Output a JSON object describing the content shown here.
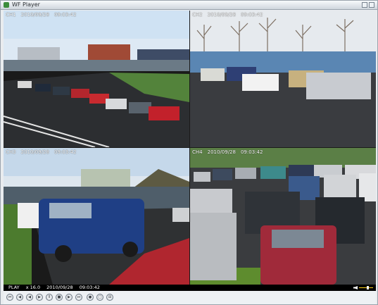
{
  "window": {
    "title": "WF Player"
  },
  "cameras": [
    {
      "id": "CH1",
      "date": "2010/09/28",
      "time": "09:03:42"
    },
    {
      "id": "CH2",
      "date": "2010/09/28",
      "time": "09:03:42"
    },
    {
      "id": "CH3",
      "date": "2010/09/28",
      "time": "09:03:42"
    },
    {
      "id": "CH4",
      "date": "2010/09/28",
      "time": "09:03:42"
    }
  ],
  "status": {
    "state": "PLAY",
    "speed": "x 16.0",
    "date": "2010/09/28",
    "time": "09:03:42"
  },
  "controls": [
    "rewind-start-icon",
    "step-back-icon",
    "reverse-play-icon",
    "play-icon",
    "pause-icon",
    "stop-icon",
    "step-forward-icon",
    "fast-forward-icon",
    "snapshot-icon",
    "single-view-icon",
    "quad-view-icon"
  ]
}
